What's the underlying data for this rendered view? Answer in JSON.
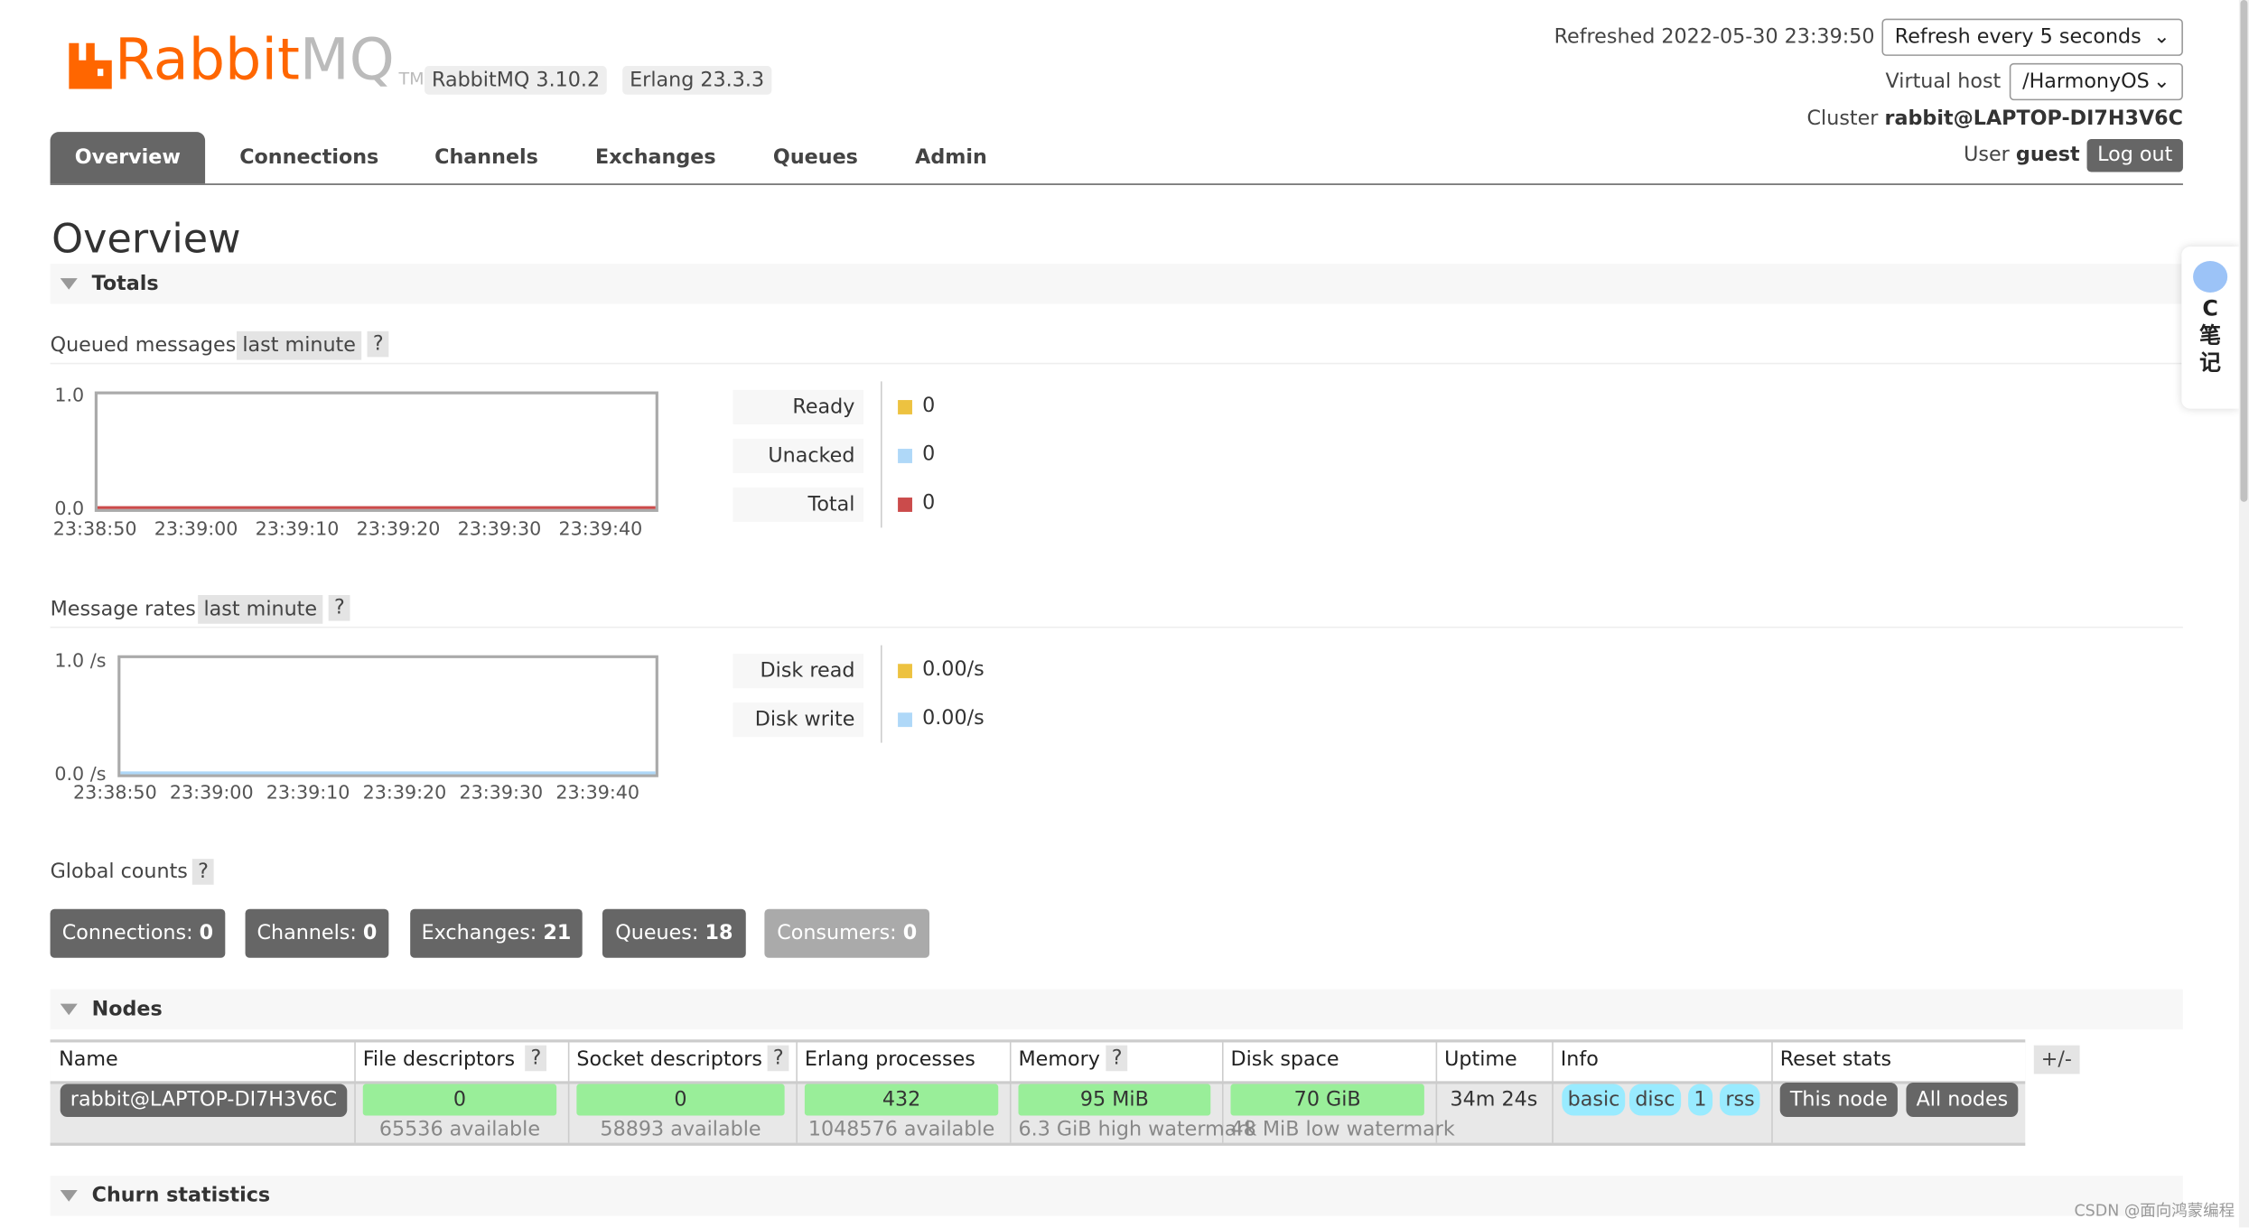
{
  "header": {
    "logo_text": "RabbitMQ",
    "logo_tm": "TM",
    "rabbitmq_version": "RabbitMQ 3.10.2",
    "erlang_version": "Erlang 23.3.3",
    "refreshed": "Refreshed 2022-05-30 23:39:50",
    "refresh_select": "Refresh every 5 seconds",
    "vhost_label": "Virtual host",
    "vhost_select": "/HarmonyOS",
    "cluster_label": "Cluster",
    "cluster_name": "rabbit@LAPTOP-DI7H3V6C",
    "user_label": "User",
    "user_name": "guest",
    "logout": "Log out"
  },
  "tabs": [
    {
      "label": "Overview",
      "active": true
    },
    {
      "label": "Connections"
    },
    {
      "label": "Channels"
    },
    {
      "label": "Exchanges"
    },
    {
      "label": "Queues"
    },
    {
      "label": "Admin"
    }
  ],
  "page_title": "Overview",
  "totals": {
    "title": "Totals",
    "queued": {
      "label": "Queued messages",
      "range": "last minute",
      "help": "?",
      "y_ticks": [
        "1.0",
        "0.0"
      ],
      "x_ticks": [
        "23:38:50",
        "23:39:00",
        "23:39:10",
        "23:39:20",
        "23:39:30",
        "23:39:40"
      ],
      "legend": [
        {
          "label": "Ready",
          "value": "0",
          "color": "#edc240"
        },
        {
          "label": "Unacked",
          "value": "0",
          "color": "#afd8f8"
        },
        {
          "label": "Total",
          "value": "0",
          "color": "#cb4b4b"
        }
      ]
    },
    "rates": {
      "label": "Message rates",
      "range": "last minute",
      "help": "?",
      "y_ticks": [
        "1.0 /s",
        "0.0 /s"
      ],
      "x_ticks": [
        "23:38:50",
        "23:39:00",
        "23:39:10",
        "23:39:20",
        "23:39:30",
        "23:39:40"
      ],
      "legend": [
        {
          "label": "Disk read",
          "value": "0.00/s",
          "color": "#edc240"
        },
        {
          "label": "Disk write",
          "value": "0.00/s",
          "color": "#afd8f8"
        }
      ]
    },
    "global_counts_label": "Global counts",
    "global_help": "?",
    "counts": [
      {
        "label": "Connections:",
        "value": "0"
      },
      {
        "label": "Channels:",
        "value": "0"
      },
      {
        "label": "Exchanges:",
        "value": "21"
      },
      {
        "label": "Queues:",
        "value": "18"
      },
      {
        "label": "Consumers:",
        "value": "0"
      }
    ]
  },
  "nodes": {
    "title": "Nodes",
    "columns": [
      "Name",
      "File descriptors",
      "Socket descriptors",
      "Erlang processes",
      "Memory",
      "Disk space",
      "Uptime",
      "Info",
      "Reset stats"
    ],
    "help": "?",
    "toggle": "+/-",
    "row": {
      "name": "rabbit@LAPTOP-DI7H3V6C",
      "fd": "0",
      "fd_avail": "65536 available",
      "sd": "0",
      "sd_avail": "58893 available",
      "ep": "432",
      "ep_avail": "1048576 available",
      "mem": "95 MiB",
      "mem_sub": "6.3 GiB high watermark",
      "disk": "70 GiB",
      "disk_sub": "48 MiB low watermark",
      "uptime": "34m 24s",
      "info": [
        "basic",
        "disc",
        "1",
        "rss"
      ],
      "reset": [
        "This node",
        "All nodes"
      ]
    }
  },
  "churn_title": "Churn statistics",
  "side_widget": {
    "text": "C\n笔\n记"
  },
  "watermark": "CSDN @面向鸿蒙编程"
}
